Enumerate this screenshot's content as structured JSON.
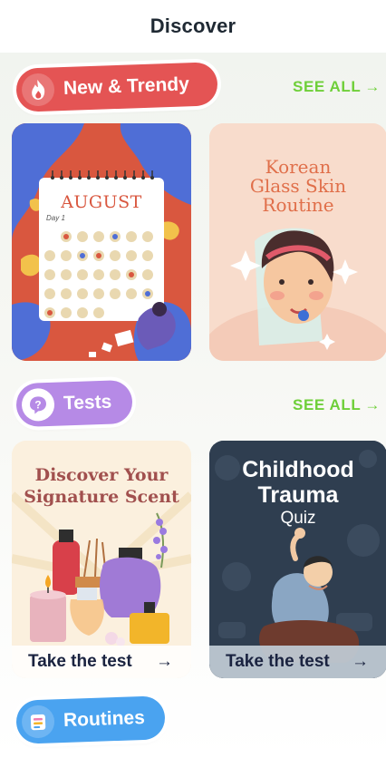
{
  "header": {
    "title": "Discover"
  },
  "sections": {
    "trendy": {
      "label": "New & Trendy",
      "see_all": "SEE ALL",
      "icon": "flame-icon",
      "color": "#e45454"
    },
    "tests": {
      "label": "Tests",
      "see_all": "SEE ALL",
      "icon": "question-icon",
      "color": "#b68ae6"
    },
    "routines": {
      "label": "Routines",
      "icon": "list-icon",
      "color": "#4aa3f0"
    }
  },
  "trendy_cards": {
    "august": {
      "month": "AUGUST",
      "day_label": "Day 1"
    },
    "korean": {
      "title_line1": "Korean",
      "title_line2": "Glass Skin",
      "title_line3": "Routine"
    }
  },
  "test_cards": {
    "scent": {
      "title_line1": "Discover Your",
      "title_line2": "Signature Scent",
      "cta": "Take the test"
    },
    "trauma": {
      "title_line1": "Childhood",
      "title_line2": "Trauma",
      "title_line3": "Quiz",
      "cta": "Take the test"
    }
  },
  "colors": {
    "accent_green": "#6fcf3a",
    "trendy_red": "#e45454",
    "tests_purple": "#b68ae6",
    "routines_blue": "#4aa3f0"
  }
}
